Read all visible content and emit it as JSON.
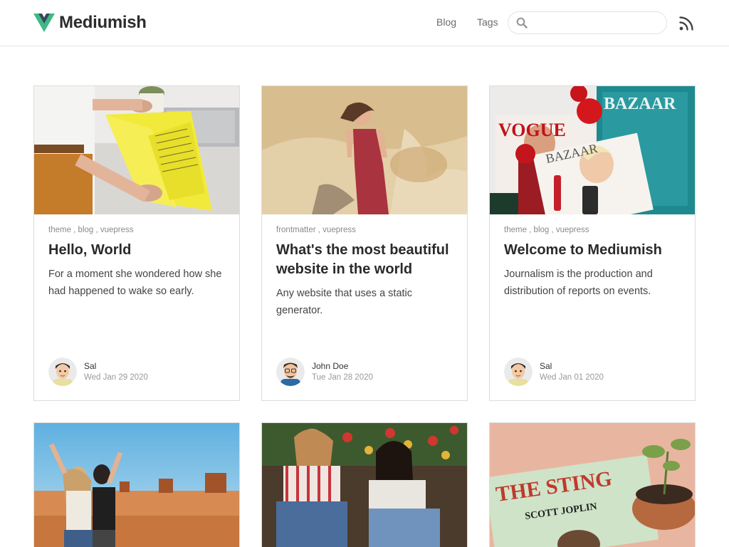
{
  "header": {
    "brand": "Mediumish",
    "nav": [
      {
        "label": "Blog"
      },
      {
        "label": "Tags"
      }
    ],
    "search": {
      "placeholder": "",
      "value": ""
    },
    "colors": {
      "brand_green": "#41b883",
      "brand_dark": "#35495e"
    }
  },
  "posts": [
    {
      "tags": "theme , blog , vuepress",
      "title": "Hello, World",
      "excerpt": "For a moment she wondered how she had happened to wake so early.",
      "author": "Sal",
      "date": "Wed Jan 29 2020",
      "image": "person-reading-yellow-magazine"
    },
    {
      "tags": "frontmatter , vuepress",
      "title": "What's the most beautiful website in the world",
      "excerpt": "Any website that uses a static generator.",
      "author": "John Doe",
      "date": "Tue Jan 28 2020",
      "image": "girl-in-red-dress-by-rock"
    },
    {
      "tags": "theme , blog , vuepress",
      "title": "Welcome to Mediumish",
      "excerpt": "Journalism is the production and distribution of reports on events.",
      "author": "Sal",
      "date": "Wed Jan 01 2020",
      "image": "fashion-magazines-flatlay"
    },
    {
      "image": "two-women-in-desert"
    },
    {
      "image": "friends-sitting-by-tulips"
    },
    {
      "image": "the-sting-record-and-plant"
    }
  ]
}
